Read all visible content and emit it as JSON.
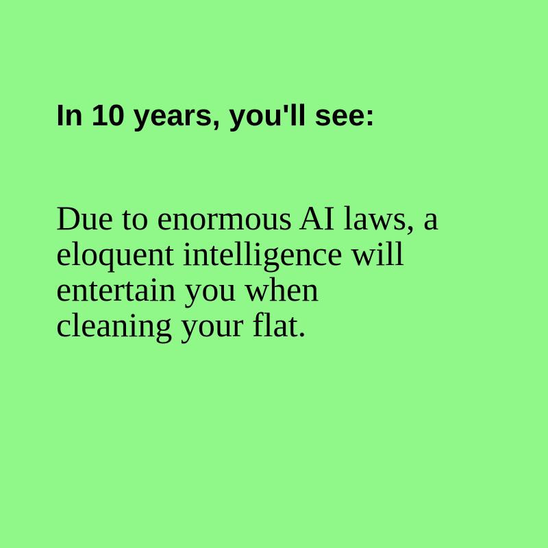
{
  "heading": "In 10 years, you'll see:",
  "body_lines": [
    "Due to enormous AI laws, a",
    "eloquent intelligence will",
    "entertain you when",
    "cleaning your flat."
  ],
  "colors": {
    "background": "#90f888",
    "text": "#000000"
  }
}
